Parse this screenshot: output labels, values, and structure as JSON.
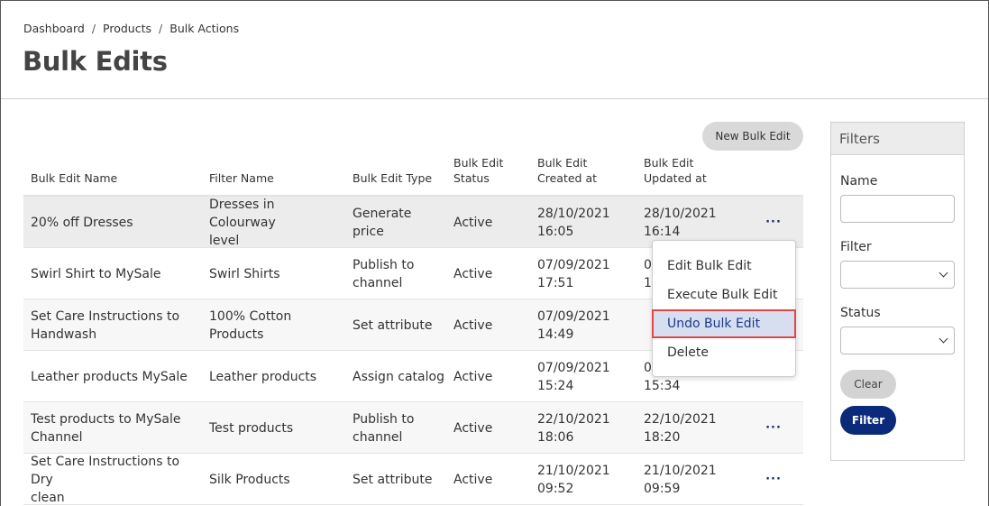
{
  "breadcrumb": {
    "items": [
      "Dashboard",
      "Products",
      "Bulk Actions"
    ],
    "separator": "/"
  },
  "page": {
    "title": "Bulk Edits"
  },
  "toolbar": {
    "new_label": "New Bulk Edit"
  },
  "table": {
    "headers": [
      "Bulk Edit Name",
      "Filter Name",
      "Bulk Edit Type",
      "Bulk Edit Status",
      "Bulk Edit Created at",
      "Bulk Edit Updated at"
    ],
    "headers_lines": [
      [
        "Bulk Edit Name"
      ],
      [
        "Filter Name"
      ],
      [
        "Bulk Edit Type"
      ],
      [
        "Bulk Edit",
        "Status"
      ],
      [
        "Bulk Edit",
        "Created at"
      ],
      [
        "Bulk Edit",
        "Updated at"
      ]
    ],
    "rows": [
      {
        "name": [
          "20% off Dresses"
        ],
        "filter": [
          "Dresses in Colourway",
          "level"
        ],
        "type": [
          "Generate",
          "price"
        ],
        "status": "Active",
        "created": [
          "28/10/2021",
          "16:05"
        ],
        "updated": [
          "28/10/2021",
          "16:14"
        ]
      },
      {
        "name": [
          "Swirl Shirt to MySale"
        ],
        "filter": [
          "Swirl Shirts"
        ],
        "type": [
          "Publish to",
          "channel"
        ],
        "status": "Active",
        "created": [
          "07/09/2021",
          "17:51"
        ],
        "updated": [
          "0",
          "1"
        ]
      },
      {
        "name": [
          "Set Care Instructions to",
          "Handwash"
        ],
        "filter": [
          "100% Cotton",
          "Products"
        ],
        "type": [
          "Set attribute"
        ],
        "status": "Active",
        "created": [
          "07/09/2021",
          "14:49"
        ],
        "updated": [
          "",
          ""
        ]
      },
      {
        "name": [
          "Leather products MySale"
        ],
        "filter": [
          "Leather products"
        ],
        "type": [
          "Assign catalog"
        ],
        "status": "Active",
        "created": [
          "07/09/2021",
          "15:24"
        ],
        "updated": [
          "0",
          "15:34"
        ]
      },
      {
        "name": [
          "Test products to MySale",
          "Channel"
        ],
        "filter": [
          "Test products"
        ],
        "type": [
          "Publish to",
          "channel"
        ],
        "status": "Active",
        "created": [
          "22/10/2021",
          "18:06"
        ],
        "updated": [
          "22/10/2021",
          "18:20"
        ]
      },
      {
        "name": [
          "Set Care Instructions to Dry",
          "clean"
        ],
        "filter": [
          "Silk Products"
        ],
        "type": [
          "Set attribute"
        ],
        "status": "Active",
        "created": [
          "21/10/2021",
          "09:52"
        ],
        "updated": [
          "21/10/2021",
          "09:59"
        ]
      }
    ],
    "row_action_glyph": "···"
  },
  "context_menu": {
    "items": [
      "Edit Bulk Edit",
      "Execute Bulk Edit",
      "Undo Bulk Edit",
      "Delete"
    ],
    "highlighted_index": 2
  },
  "filters": {
    "title": "Filters",
    "name_label": "Name",
    "name_value": "",
    "filter_label": "Filter",
    "filter_value": "",
    "status_label": "Status",
    "status_value": "",
    "clear_label": "Clear",
    "apply_label": "Filter"
  },
  "colors": {
    "primary": "#0c2a7a",
    "highlight_row": "#ececec",
    "menu_active_bg": "#d7def0",
    "menu_active_border": "#e04848"
  }
}
